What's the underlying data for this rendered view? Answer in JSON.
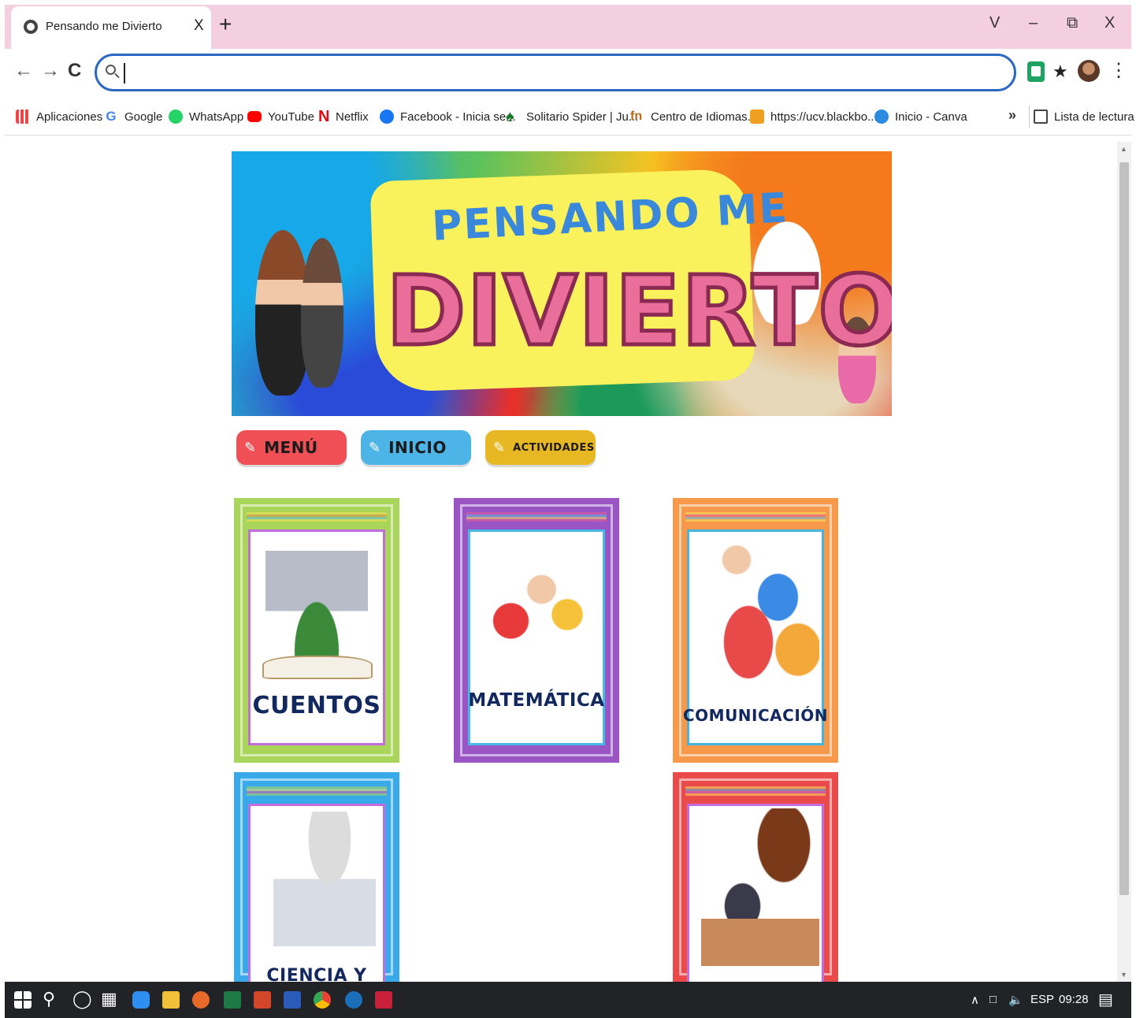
{
  "browser": {
    "tab_title": "Pensando me Divierto",
    "tab_close": "X",
    "new_tab": "+",
    "window_controls": {
      "menu": "V",
      "minimize": "–",
      "restore": "⧉",
      "close": "X"
    },
    "nav": {
      "back": "←",
      "forward": "→",
      "reload": "C"
    },
    "address_value": "",
    "toolbar_more": "⋮",
    "extension_icon": "★"
  },
  "bookmarks": {
    "items": [
      {
        "label": "Aplicaciones",
        "icon": "apps-grid-icon",
        "color": "#4a78e0"
      },
      {
        "label": "Google",
        "icon": "google-icon",
        "color": "#4285f4"
      },
      {
        "label": "WhatsApp",
        "icon": "whatsapp-icon",
        "color": "#25d366"
      },
      {
        "label": "YouTube",
        "icon": "youtube-icon",
        "color": "#ff0000"
      },
      {
        "label": "Netflix",
        "icon": "netflix-icon",
        "color": "#e50914"
      },
      {
        "label": "Facebook - Inicia se...",
        "icon": "facebook-icon",
        "color": "#1877f2"
      },
      {
        "label": "Solitario Spider | Ju...",
        "icon": "spade-icon",
        "color": "#1a7a2a"
      },
      {
        "label": "Centro de Idiomas...",
        "icon": "idiomas-icon",
        "color": "#b36a1a"
      },
      {
        "label": "https://ucv.blackbo...",
        "icon": "pencil-icon",
        "color": "#f0a020"
      },
      {
        "label": "Inicio - Canva",
        "icon": "canva-icon",
        "color": "#2a8be0"
      }
    ],
    "more": "»",
    "reading_list": "Lista de lectura"
  },
  "page": {
    "banner": {
      "line1": "PENSANDO ME",
      "line2": "DIVIERTO"
    },
    "menu_buttons": [
      {
        "label": "MENÚ",
        "color": "#ef4f55",
        "icon": "pencil-icon"
      },
      {
        "label": "INICIO",
        "color": "#4cb4e6",
        "icon": "pencil-icon"
      },
      {
        "label": "ACTIVIDADES",
        "color": "#e8b824",
        "icon": "pencil-icon"
      }
    ],
    "cards": [
      {
        "label": "CUENTOS",
        "outer_color": "#a8d55a",
        "inner_color": "#c46be0"
      },
      {
        "label": "MATEMÁTICA",
        "outer_color": "#9a55c4",
        "inner_color": "#48b8e6"
      },
      {
        "label": "COMUNICACIÓN",
        "outer_color": "#f7994a",
        "inner_color": "#45b5e0"
      },
      {
        "label": "CIENCIA Y",
        "outer_color": "#38aaea",
        "inner_color": "#c46be0"
      },
      {
        "label": "",
        "outer_color": "#ea4a4a",
        "inner_color": "#c46be0"
      }
    ]
  },
  "taskbar": {
    "tray_lang": "ESP",
    "clock": "09:28",
    "tray_arrow": "∧"
  }
}
